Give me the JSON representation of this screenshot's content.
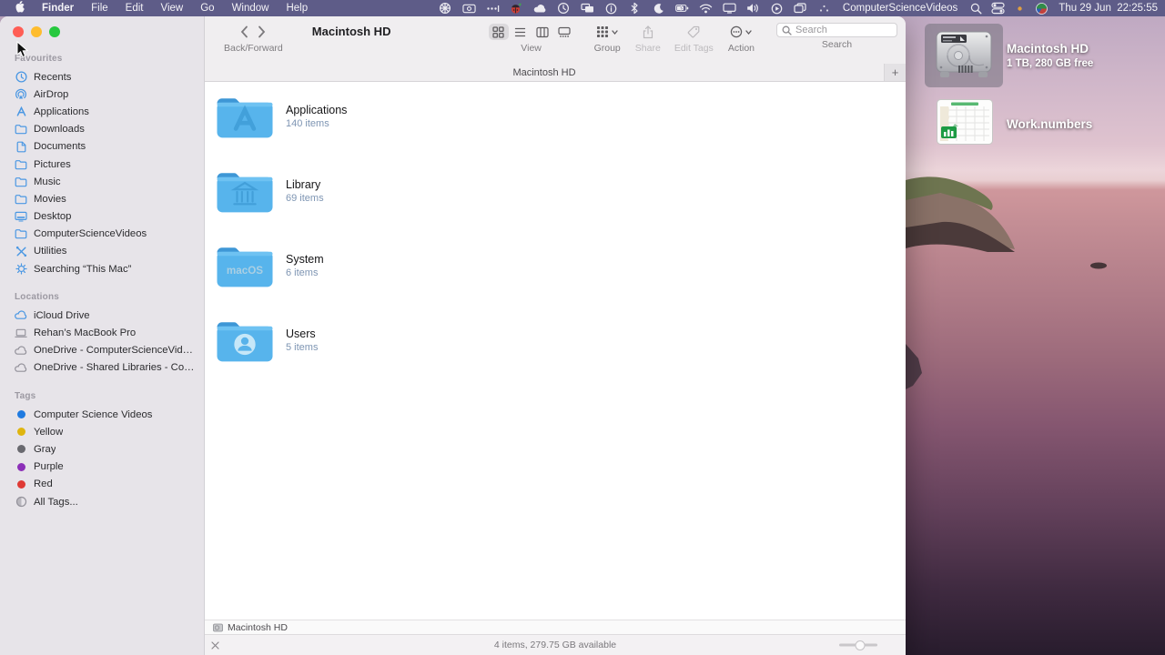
{
  "colors": {
    "menu_bar": "#5e5c88",
    "folder_blue": "#55b3ec",
    "sidebar_icon_blue": "#4a97e3",
    "item_count_blue": "#7e95b3",
    "selection_grey": "rgba(112,110,120,0.52)"
  },
  "menu_bar": {
    "apple_icon": "apple-logo",
    "items": [
      "Finder",
      "File",
      "Edit",
      "View",
      "Go",
      "Window",
      "Help"
    ],
    "status_icons": [
      "pinwheel",
      "screen-record",
      "more-dots",
      "ladybug",
      "cloud",
      "time-machine",
      "display-mirror",
      "info",
      "bluetooth",
      "moon",
      "battery-charging",
      "wifi",
      "display",
      "volume",
      "play-circle",
      "windows-copy",
      "dots-triangle"
    ],
    "user_label": "ComputerScienceVideos",
    "right_icons": [
      "spotlight",
      "control-center",
      "notification-dot",
      "avatar"
    ],
    "clock": "Thu 29 Jun  22:25:55"
  },
  "window": {
    "title": "Macintosh HD",
    "toolbar": {
      "back_forward_label": "Back/Forward",
      "view_label": "View",
      "group_label": "Group",
      "share_label": "Share",
      "edit_tags_label": "Edit Tags",
      "action_label": "Action",
      "search_label": "Search",
      "search_placeholder": "Search"
    },
    "tab_bar": {
      "tab_title": "Macintosh HD",
      "add_tab": "+"
    },
    "sidebar": {
      "sections": [
        {
          "title": "Favourites",
          "items": [
            {
              "icon": "recents",
              "label": "Recents"
            },
            {
              "icon": "airdrop",
              "label": "AirDrop"
            },
            {
              "icon": "appstore",
              "label": "Applications"
            },
            {
              "icon": "folder",
              "label": "Downloads"
            },
            {
              "icon": "doc",
              "label": "Documents"
            },
            {
              "icon": "folder",
              "label": "Pictures"
            },
            {
              "icon": "folder",
              "label": "Music"
            },
            {
              "icon": "folder",
              "label": "Movies"
            },
            {
              "icon": "desktop",
              "label": "Desktop"
            },
            {
              "icon": "folder",
              "label": "ComputerScienceVideos"
            },
            {
              "icon": "utilities",
              "label": "Utilities"
            },
            {
              "icon": "gear",
              "label": "Searching “This Mac”"
            }
          ]
        },
        {
          "title": "Locations",
          "items": [
            {
              "icon": "cloud-blue",
              "label": "iCloud Drive"
            },
            {
              "icon": "laptop",
              "label": "Rehan’s MacBook Pro",
              "gray": true
            },
            {
              "icon": "cloud-grey",
              "label": "OneDrive - ComputerScienceVideos",
              "gray": true
            },
            {
              "icon": "cloud-grey",
              "label": "OneDrive - Shared Libraries - Comp...",
              "gray": true
            }
          ]
        },
        {
          "title": "Tags",
          "items": [
            {
              "color": "#1f7ae0",
              "label": "Computer Science Videos"
            },
            {
              "color": "#dfb50f",
              "label": "Yellow"
            },
            {
              "color": "#69696f",
              "label": "Gray"
            },
            {
              "color": "#8c2fb8",
              "label": "Purple"
            },
            {
              "color": "#df3a35",
              "label": "Red"
            },
            {
              "icon": "all-tags",
              "label": "All Tags...",
              "gray": true
            }
          ]
        }
      ]
    },
    "content": {
      "folders": [
        {
          "name": "Applications",
          "info": "140 items",
          "glyph": "appstore"
        },
        {
          "name": "Library",
          "info": "69 items",
          "glyph": "bank"
        },
        {
          "name": "System",
          "info": "6 items",
          "glyph": "macos"
        },
        {
          "name": "Users",
          "info": "5 items",
          "glyph": "person"
        }
      ]
    },
    "path_bar": {
      "icon": "disk",
      "text": "Macintosh HD"
    },
    "status_bar": {
      "text": "4 items, 279.75 GB available"
    }
  },
  "desktop": {
    "icons": [
      {
        "label": "Macintosh HD",
        "sublabel": "1 TB, 280 GB free",
        "selected": true
      },
      {
        "label": "Work.numbers",
        "selected": false
      }
    ]
  }
}
